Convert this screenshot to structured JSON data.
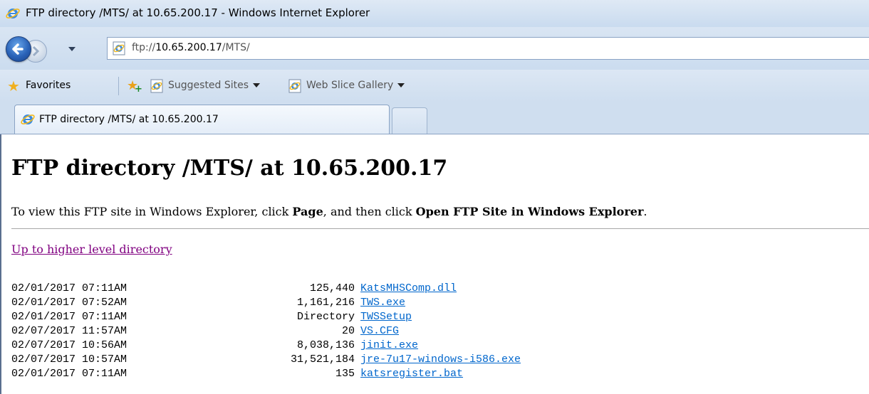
{
  "window": {
    "title": "FTP directory /MTS/ at 10.65.200.17 - Windows Internet Explorer"
  },
  "nav": {
    "address_prefix": "ftp://",
    "address_host": "10.65.200.17",
    "address_path": "/MTS/"
  },
  "favorites_bar": {
    "favorites_label": "Favorites",
    "links": [
      {
        "label": "Suggested Sites"
      },
      {
        "label": "Web Slice Gallery"
      }
    ]
  },
  "tabs": [
    {
      "label": "FTP directory /MTS/ at 10.65.200.17"
    }
  ],
  "page": {
    "heading": "FTP directory /MTS/ at 10.65.200.17",
    "intro_before": "To view this FTP site in Windows Explorer, click ",
    "intro_bold1": "Page",
    "intro_middle": ", and then click ",
    "intro_bold2": "Open FTP Site in Windows Explorer",
    "intro_after": ".",
    "up_link": "Up to higher level directory",
    "files": [
      {
        "date": "02/01/2017 07:11AM",
        "size": "125,440",
        "name": "KatsMHSComp.dll"
      },
      {
        "date": "02/01/2017 07:52AM",
        "size": "1,161,216",
        "name": "TWS.exe"
      },
      {
        "date": "02/01/2017 07:11AM",
        "size": "Directory",
        "name": "TWSSetup"
      },
      {
        "date": "02/07/2017 11:57AM",
        "size": "20",
        "name": "VS.CFG"
      },
      {
        "date": "02/07/2017 10:56AM",
        "size": "8,038,136",
        "name": "jinit.exe"
      },
      {
        "date": "02/07/2017 10:57AM",
        "size": "31,521,184",
        "name": "jre-7u17-windows-i586.exe"
      },
      {
        "date": "02/01/2017 07:11AM",
        "size": "135",
        "name": "katsregister.bat"
      }
    ]
  },
  "colors": {
    "link": "#0066cc",
    "visited_link": "#800080",
    "chrome_blue": "#cfdeef"
  }
}
